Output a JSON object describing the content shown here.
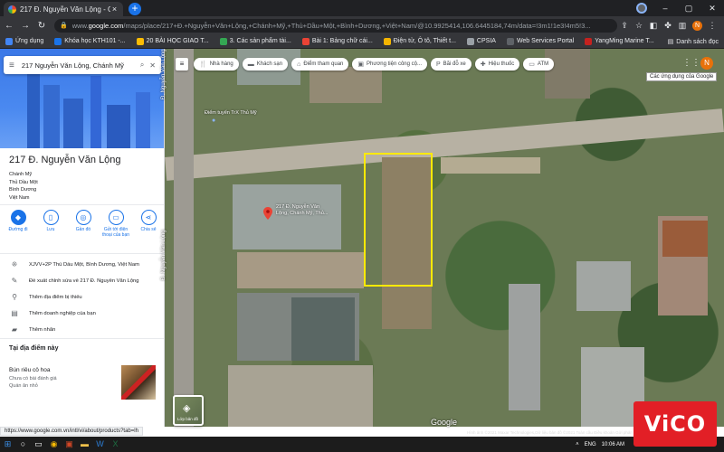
{
  "browser": {
    "tab_title": "217 Đ. Nguyễn Văn Lộng - Goog",
    "url_host": "google.com",
    "url_path": "/maps/place/217+Đ.+Nguyễn+Văn+Lộng,+Chánh+Mỹ,+Thủ+Dầu+Một,+Bình+Dương,+Việt+Nam/@10.9925414,106.6445184,74m/data=!3m1!1e3!4m5!3...",
    "url_prefix": "www."
  },
  "bookmarks": [
    {
      "label": "Ứng dụng",
      "color": "#4285f4"
    },
    {
      "label": "Khóa học KTH101 -...",
      "color": "#1a73e8"
    },
    {
      "label": "20 BÀI HỌC GIAO T...",
      "color": "#fbbc04"
    },
    {
      "label": "3. Các sản phẩm tài...",
      "color": "#34a853"
    },
    {
      "label": "Bài 1: Bảng chữ cái...",
      "color": "#ea4335"
    },
    {
      "label": "Điện tử, Ô tô, Thiết t...",
      "color": "#f4b400"
    },
    {
      "label": "CPSIA",
      "color": "#9aa0a6"
    },
    {
      "label": "Web Services Portal",
      "color": "#5f6368"
    },
    {
      "label": "YangMing Marine T...",
      "color": "#c5221f"
    }
  ],
  "bookmarks_reading_list": "Danh sách đọc",
  "search": {
    "query": "217 Nguyễn Văn Lộng, Chánh Mỹ"
  },
  "place": {
    "name": "217 Đ. Nguyễn Văn Lộng",
    "address_lines": [
      "Chánh Mỹ",
      "Thủ Dầu Một",
      "Bình Dương",
      "Việt Nam"
    ]
  },
  "actions": [
    {
      "label": "Đường đi",
      "icon": "directions-icon",
      "glyph": "◆",
      "filled": true
    },
    {
      "label": "Lưu",
      "icon": "bookmark-icon",
      "glyph": "▯",
      "filled": false
    },
    {
      "label": "Gần đó",
      "icon": "nearby-icon",
      "glyph": "◎",
      "filled": false
    },
    {
      "label": "Gửi tới điện thoại của bạn",
      "icon": "send-to-phone-icon",
      "glyph": "▭",
      "filled": false
    },
    {
      "label": "Chia sẻ",
      "icon": "share-icon",
      "glyph": "⋖",
      "filled": false
    }
  ],
  "info_rows": [
    {
      "text": "XJVV+2P Thủ Dầu Một, Bình Dương, Việt Nam",
      "icon": "plus-code-icon",
      "glyph": "⁜"
    },
    {
      "text": "Đề xuất chỉnh sửa về 217 Đ. Nguyễn Văn Lộng",
      "icon": "edit-icon",
      "glyph": "✎"
    },
    {
      "text": "Thêm địa điểm bị thiếu",
      "icon": "add-place-icon",
      "glyph": "⚲"
    },
    {
      "text": "Thêm doanh nghiệp của bạn",
      "icon": "business-icon",
      "glyph": "▤"
    },
    {
      "text": "Thêm nhãn",
      "icon": "label-icon",
      "glyph": "▰"
    }
  ],
  "here": {
    "title": "Tại địa điểm này",
    "name": "Bún riêu cô hoa",
    "sub1": "Chưa có bài đánh giá",
    "sub2": "Quán ăn nhỏ"
  },
  "chips": [
    {
      "label": "Nhà hàng",
      "icon": "restaurant-icon",
      "glyph": "🍴"
    },
    {
      "label": "Khách sạn",
      "icon": "hotel-icon",
      "glyph": "▬"
    },
    {
      "label": "Điểm tham quan",
      "icon": "attraction-icon",
      "glyph": "⌂"
    },
    {
      "label": "Phương tiện công cộ...",
      "icon": "transit-icon",
      "glyph": "▣"
    },
    {
      "label": "Bãi đỗ xe",
      "icon": "parking-icon",
      "glyph": "P"
    },
    {
      "label": "Hiệu thuốc",
      "icon": "pharmacy-icon",
      "glyph": "✚"
    },
    {
      "label": "ATM",
      "icon": "atm-icon",
      "glyph": "▭"
    }
  ],
  "map": {
    "tooltip": "Các ứng dụng của Google",
    "avatar_letter": "N",
    "road_label": "Đ. Nguyễn Văn Lộng",
    "road_label_top": "Đ. Nguyễn Văn Lộng",
    "poi_label": "Điểm tuyển TrX Thủ Mỹ",
    "pin_label": "217 Đ. Nguyễn Văn Lộng, Chánh Mỹ, Thủ...",
    "layers_label": "Lớp bản đồ",
    "logo": "Google",
    "attribution": "Hình ảnh ©2021 Maxar Technologies,Dữ liệu bản đồ ©2021   Toàn cầu   Điều khoản   Gửi phản hồi   10 m"
  },
  "status_url": "https://www.google.com.vn/intl/vi/about/products?tab=lh",
  "tray": {
    "lang": "ENG",
    "time": "10:06 AM"
  },
  "watermark": "ViCO",
  "colors": {
    "accent": "#1a73e8",
    "highlight": "#ffea00",
    "watermark_bg": "#e21f26"
  }
}
